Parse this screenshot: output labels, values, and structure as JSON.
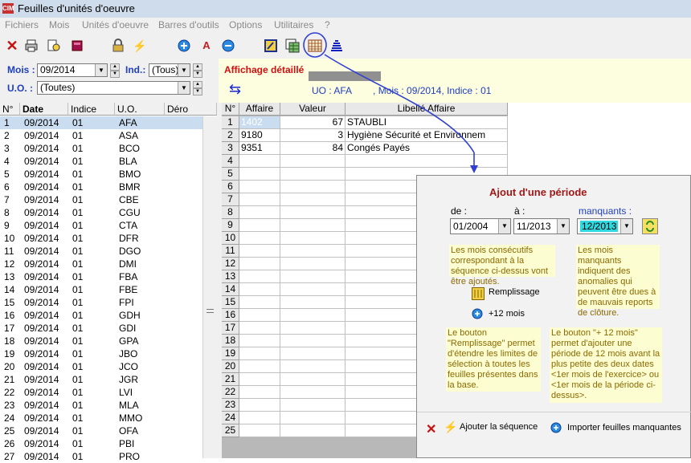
{
  "window": {
    "title": "Feuilles d'unités d'oeuvre",
    "logo_text": "CIM"
  },
  "menu": [
    "Fichiers",
    "Mois",
    "Unités d'oeuvre",
    "Barres d'outils",
    "Options",
    "Utilitaires",
    "?"
  ],
  "filters": {
    "mois_label": "Mois :",
    "mois_value": "09/2014",
    "ind_label": "Ind.:",
    "ind_value": "(Tous)",
    "uo_label": "U.O. :",
    "uo_value": "(Toutes)"
  },
  "info": {
    "title": "Affichage détaillé",
    "detail": "UO : AFA        , Mois : 09/2014, Indice : 01"
  },
  "left_grid": {
    "columns": [
      "N°",
      "Date",
      "Indice",
      "U.O.",
      "Déro"
    ],
    "rows": [
      [
        "1",
        "09/2014",
        "01",
        "AFA"
      ],
      [
        "2",
        "09/2014",
        "01",
        "ASA"
      ],
      [
        "3",
        "09/2014",
        "01",
        "BCO"
      ],
      [
        "4",
        "09/2014",
        "01",
        "BLA"
      ],
      [
        "5",
        "09/2014",
        "01",
        "BMO"
      ],
      [
        "6",
        "09/2014",
        "01",
        "BMR"
      ],
      [
        "7",
        "09/2014",
        "01",
        "CBE"
      ],
      [
        "8",
        "09/2014",
        "01",
        "CGU"
      ],
      [
        "9",
        "09/2014",
        "01",
        "CTA"
      ],
      [
        "10",
        "09/2014",
        "01",
        "DFR"
      ],
      [
        "11",
        "09/2014",
        "01",
        "DGO"
      ],
      [
        "12",
        "09/2014",
        "01",
        "DMI"
      ],
      [
        "13",
        "09/2014",
        "01",
        "FBA"
      ],
      [
        "14",
        "09/2014",
        "01",
        "FBE"
      ],
      [
        "15",
        "09/2014",
        "01",
        "FPI"
      ],
      [
        "16",
        "09/2014",
        "01",
        "GDH"
      ],
      [
        "17",
        "09/2014",
        "01",
        "GDI"
      ],
      [
        "18",
        "09/2014",
        "01",
        "GPA"
      ],
      [
        "19",
        "09/2014",
        "01",
        "JBO"
      ],
      [
        "20",
        "09/2014",
        "01",
        "JCO"
      ],
      [
        "21",
        "09/2014",
        "01",
        "JGR"
      ],
      [
        "22",
        "09/2014",
        "01",
        "LVI"
      ],
      [
        "23",
        "09/2014",
        "01",
        "MLA"
      ],
      [
        "24",
        "09/2014",
        "01",
        "MMO"
      ],
      [
        "25",
        "09/2014",
        "01",
        "OFA"
      ],
      [
        "26",
        "09/2014",
        "01",
        "PBI"
      ],
      [
        "27",
        "09/2014",
        "01",
        "PRO"
      ]
    ]
  },
  "right_grid": {
    "columns": [
      "N°",
      "Affaire",
      "Valeur",
      "Libellé Affaire"
    ],
    "rows": [
      [
        "1",
        "1402",
        "67",
        "STAUBLI"
      ],
      [
        "2",
        "9180",
        "3",
        "Hygiène Sécurité et Environnem"
      ],
      [
        "3",
        "9351",
        "84",
        "Congés Payés"
      ],
      [
        "4",
        "",
        "",
        ""
      ],
      [
        "5",
        "",
        "",
        ""
      ],
      [
        "6",
        "",
        "",
        ""
      ],
      [
        "7",
        "",
        "",
        ""
      ],
      [
        "8",
        "",
        "",
        ""
      ],
      [
        "9",
        "",
        "",
        ""
      ],
      [
        "10",
        "",
        "",
        ""
      ],
      [
        "11",
        "",
        "",
        ""
      ],
      [
        "12",
        "",
        "",
        ""
      ],
      [
        "13",
        "",
        "",
        ""
      ],
      [
        "14",
        "",
        "",
        ""
      ],
      [
        "15",
        "",
        "",
        ""
      ],
      [
        "16",
        "",
        "",
        ""
      ],
      [
        "17",
        "",
        "",
        ""
      ],
      [
        "18",
        "",
        "",
        ""
      ],
      [
        "19",
        "",
        "",
        ""
      ],
      [
        "20",
        "",
        "",
        ""
      ],
      [
        "21",
        "",
        "",
        ""
      ],
      [
        "22",
        "",
        "",
        ""
      ],
      [
        "23",
        "",
        "",
        ""
      ],
      [
        "24",
        "",
        "",
        ""
      ],
      [
        "25",
        "",
        "",
        ""
      ]
    ]
  },
  "dialog": {
    "title": "Ajout d'une période",
    "de_label": "de :",
    "de_value": "01/2004",
    "a_label": "à :",
    "a_value": "11/2013",
    "manquants_label": "manquants :",
    "manquants_value": "12/2013",
    "note_consecutifs": "Les mois consécutifs correspondant à la séquence ci-dessus vont être ajoutés.",
    "note_manquants": "Les mois manquants indiquent des anomalies qui peuvent être dues à de mauvais reports de clôture.",
    "remplissage_label": "Remplissage",
    "plus12_label": "+12 mois",
    "note_remplissage": "Le bouton \"Remplissage\" permet d'étendre les limites de sélection à toutes les feuilles présentes dans la base.",
    "note_plus12": "Le bouton \"+ 12 mois\" permet d'ajouter une période de 12 mois avant la plus petite des deux dates <1er mois de l'exercice> ou <1er mois de la période ci-dessus>.",
    "add_sequence_label": "Ajouter la séquence",
    "import_label": "Importer feuilles manquantes"
  },
  "colors": {
    "accent_blue": "#1f3fc0",
    "info_red": "#d01010",
    "annotation": "#3040d0",
    "note_text": "#8a6a00",
    "note_bg": "#fdfdd2",
    "selected_row": "#c9dcf0"
  }
}
